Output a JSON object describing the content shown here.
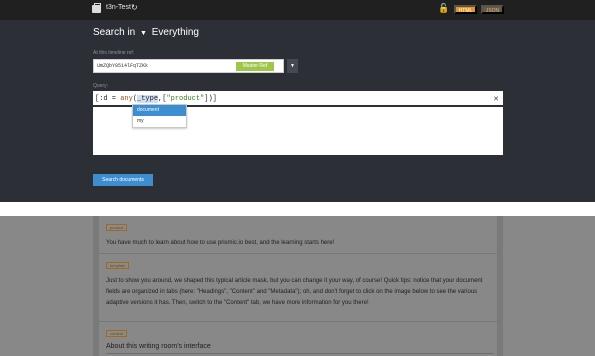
{
  "topbar": {
    "repo_name": "t3n-Test",
    "refresh_icon": "refresh-icon",
    "lock_icon": "unlock-icon",
    "html_label": "HTML",
    "json_label": "JSON"
  },
  "search": {
    "prefix": "Search in",
    "scope": "Everything",
    "ref_label": "At this timeline ref:",
    "ref_value": "UmZQbY0514lFqTZKk",
    "ref_tag": "Master Ref",
    "query_label": "Query:",
    "query_tokens": {
      "open": "[:d = ",
      "fn": "any",
      "arg_open": "(",
      "field": "_type",
      "sep": ",[",
      "str": "\"product\"",
      "close": "])]"
    },
    "clear_icon": "close-icon",
    "autocomplete": [
      "document",
      "my"
    ],
    "submit_label": "Search documents"
  },
  "results": {
    "fragments": [
      {
        "tag": "product",
        "text": "You have much to learn about how to use prismic.io best, and the learning starts here!"
      },
      {
        "tag": "template",
        "text": "Just to show you around, we shaped this typical article mask, but you can change it your way, of course! Quick tips: notice that your document fields are organized in tabs (here: \"Headings\", \"Content\" and \"Metadata\"); oh, and don't forget to click on the image below to see the various adaptive versions it has. Then, switch to the \"Content\" tab, we have more information for you there!"
      },
      {
        "tag": "content",
        "text": "About this writing room's interface"
      }
    ]
  },
  "colors": {
    "accent": "#3d8ed0",
    "panel": "#2c3036",
    "topbar": "#202020",
    "html_button": "#e8941a",
    "ref_tag": "#9dc64a"
  }
}
